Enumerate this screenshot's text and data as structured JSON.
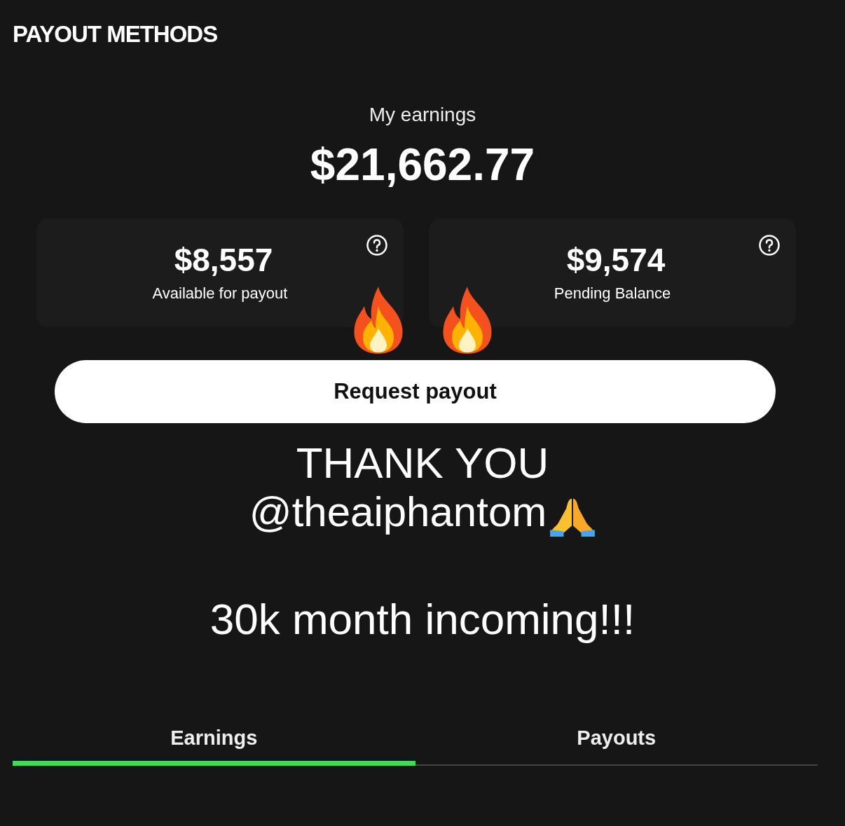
{
  "header": {
    "title": "PAYOUT METHODS"
  },
  "earnings": {
    "label": "My earnings",
    "amount": "$21,662.77"
  },
  "balances": [
    {
      "amount": "$8,557",
      "label": "Available for payout"
    },
    {
      "amount": "$9,574",
      "label": "Pending Balance"
    }
  ],
  "request_button": {
    "label": "Request payout"
  },
  "caption": {
    "line_1": "THANK YOU",
    "line_2": "@theaiphantom",
    "line_3": "30k month incoming!!!"
  },
  "tabs": [
    {
      "label": "Earnings",
      "selected": true
    },
    {
      "label": "Payouts",
      "selected": false
    }
  ]
}
